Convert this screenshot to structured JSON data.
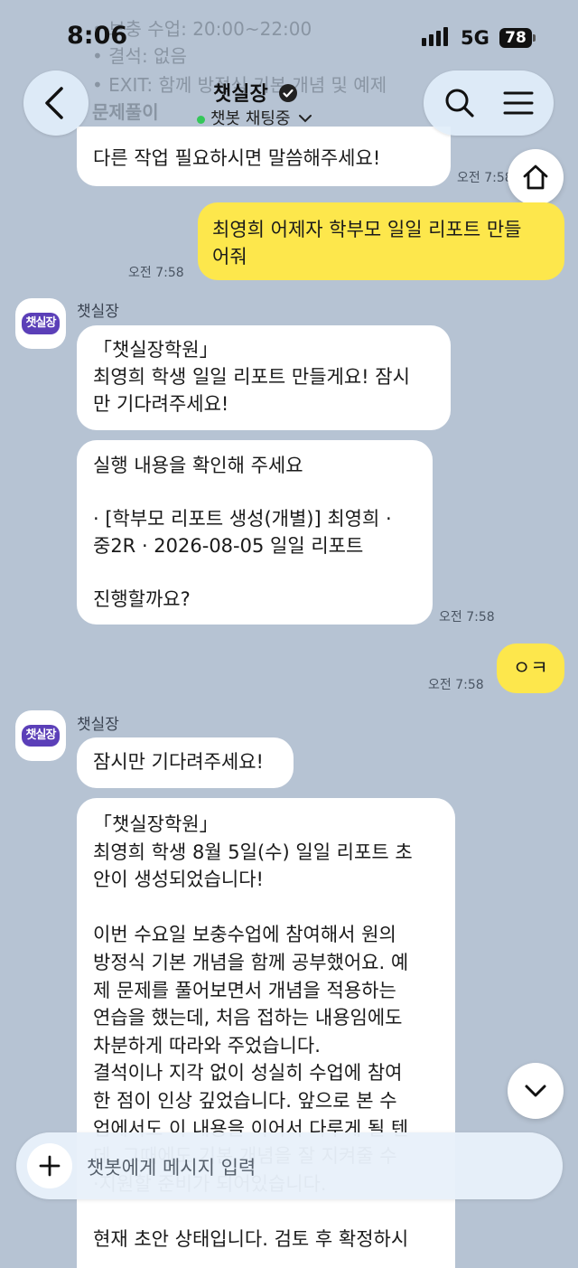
{
  "status_bar": {
    "time": "8:06",
    "network": "5G",
    "battery": "78"
  },
  "header": {
    "title": "챗실장",
    "subtitle": "챗봇 채팅중"
  },
  "background_lines": [
    "• 보충 수업: 20:00~22:00",
    "• 결석: 없음",
    "• EXIT: 함께 방정식 기본 개념 및 예제",
    "문제풀이"
  ],
  "messages": {
    "m0": {
      "text": "다른 작업 필요하시면 말씀해주세요!",
      "time": "오전 7:58"
    },
    "m1": {
      "text": "최영희 어제자 학부모 일일 리포트 만들\n어줘",
      "time": "오전 7:58"
    },
    "sender1": "챗실장",
    "m2": {
      "text": "「챗실장학원」\n최영희 학생 일일 리포트 만들게요! 잠시\n만 기다려주세요!"
    },
    "m3": {
      "text": "실행 내용을 확인해 주세요\n\n· [학부모 리포트 생성(개별)] 최영희 ·\n중2R · 2026-08-05 일일 리포트\n\n진행할까요?",
      "time": "오전 7:58"
    },
    "m4": {
      "text": "ㅇㅋ",
      "time": "오전 7:58"
    },
    "sender2": "챗실장",
    "m5": {
      "text": "잠시만 기다려주세요!"
    },
    "m6": {
      "text": "「챗실장학원」\n최영희 학생 8월 5일(수) 일일 리포트 초\n안이 생성되었습니다!\n\n이번 수요일 보충수업에 참여해서 원의\n방정식 기본 개념을 함께 공부했어요. 예\n제 문제를 풀어보면서 개념을 적용하는\n연습을 했는데, 처음 접하는 내용임에도\n차분하게 따라와 주었습니다.\n결석이나 지각 없이 성실히 수업에 참여\n한 점이 인상 깊었습니다. 앞으로 본 수\n업에서도 이 내용을 이어서 다루게 될 텐\n데, 그때에도 기본 개념을 잘 지켜줄 수\n·지원할 준비가 되어있습니다.\n\n현재 초안 상태입니다. 검토 후 확정하시"
    }
  },
  "avatar_label": "챗실장",
  "input": {
    "placeholder": "챗봇에게 메시지 입력"
  },
  "icons": [
    "back-arrow-icon",
    "verified-badge-icon",
    "chevron-down-icon",
    "search-icon",
    "menu-icon",
    "home-icon",
    "scroll-down-icon",
    "plus-icon"
  ]
}
